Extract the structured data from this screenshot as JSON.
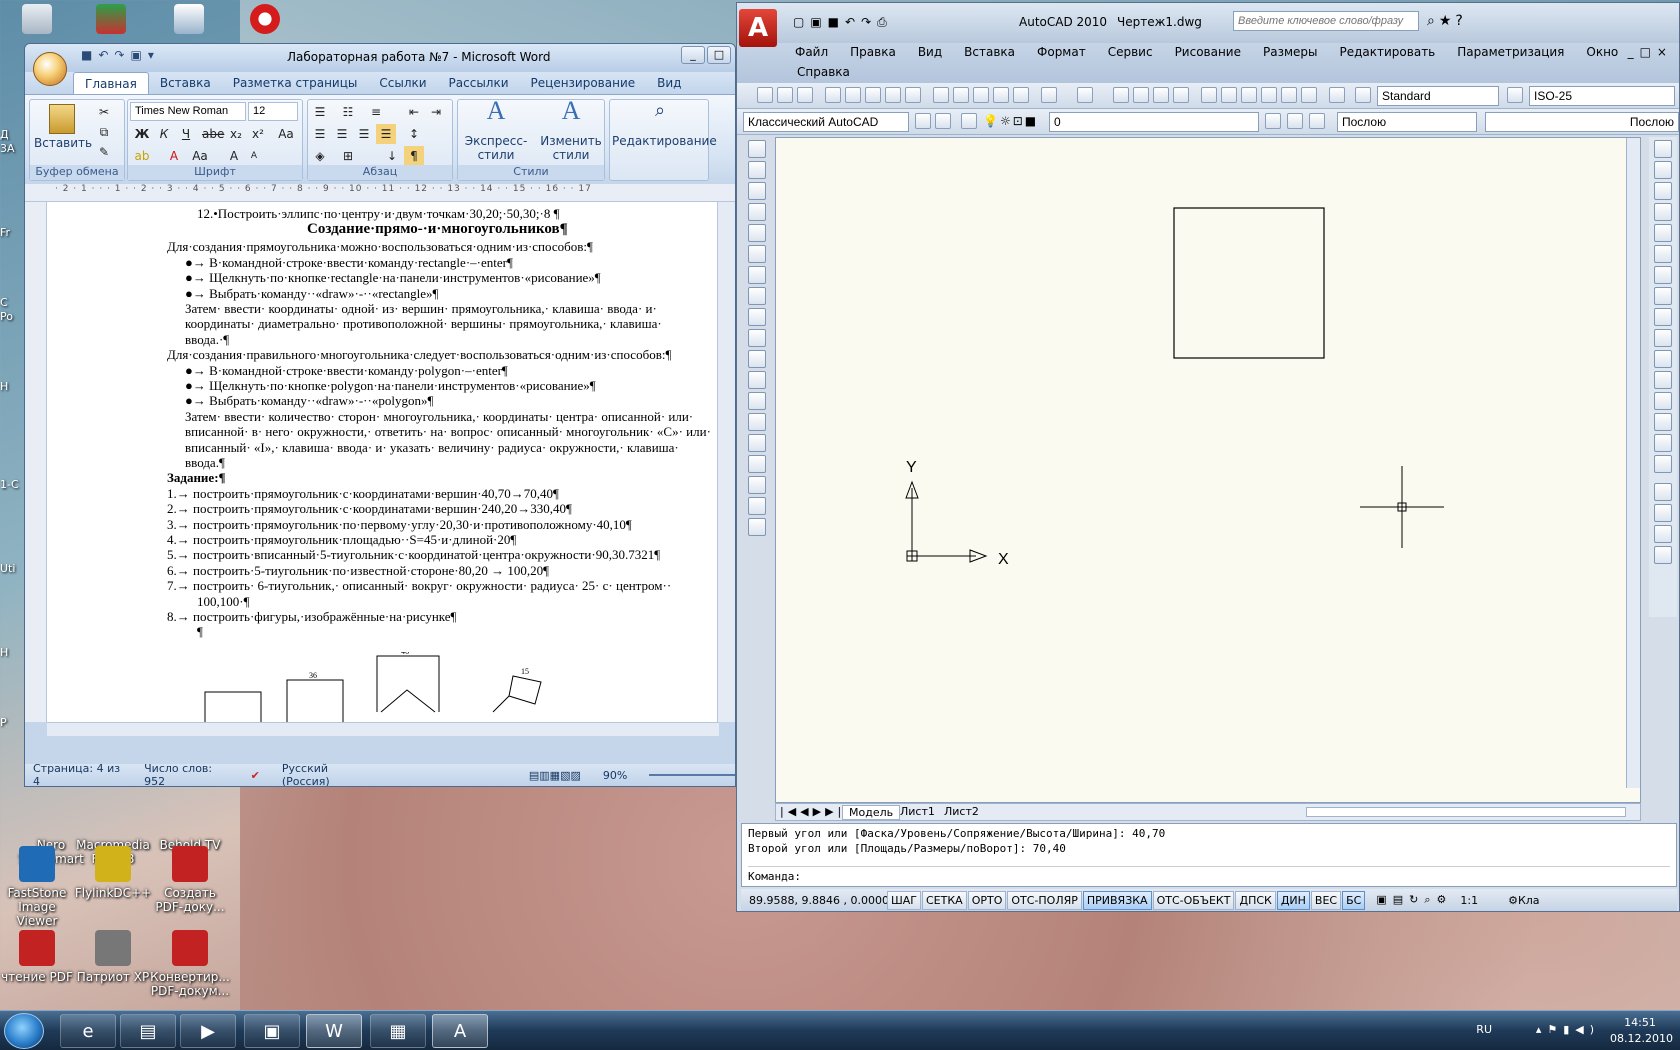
{
  "desktop": {
    "icons": [
      {
        "label": "Nero StartSmart",
        "color": "#444444"
      },
      {
        "label": "Macromedia Flash 8",
        "color": "#b01515"
      },
      {
        "label": "Behold TV",
        "color": "#2f5f9a"
      },
      {
        "label": "FastStone Image Viewer",
        "color": "#1f6bb5"
      },
      {
        "label": "FlylinkDC++",
        "color": "#d2b21a"
      },
      {
        "label": "Создать PDF-доку...",
        "color": "#c22222"
      },
      {
        "label": "чтение PDF",
        "color": "#c22222"
      },
      {
        "label": "Патриот XP",
        "color": "#777777"
      },
      {
        "label": "Конвертир... PDF-докум...",
        "color": "#c22222"
      }
    ],
    "partial_labels": [
      "Д",
      "3А",
      "Fr",
      "С",
      "Po",
      "Н",
      "1-С",
      "Uti",
      "Н",
      "Р"
    ]
  },
  "word": {
    "title": "Лабораторная работа №7 - Microsoft Word",
    "tabs": [
      "Главная",
      "Вставка",
      "Разметка страницы",
      "Ссылки",
      "Рассылки",
      "Рецензирование",
      "Вид"
    ],
    "groups": {
      "clipboard": "Буфер обмена",
      "font": "Шрифт",
      "paragraph": "Абзац",
      "styles": "Стили"
    },
    "paste": "Вставить",
    "font_name": "Times New Roman",
    "font_size": "12",
    "quick_styles": "Экспресс-стили",
    "change_styles": "Изменить стили",
    "editing": "Редактирование",
    "ruler": "· 2 · 1 · · · 1 · · 2 · · 3 · · 4 · · 5 · · 6 · · 7 · · 8 · · 9 · · 10 · · 11 · · 12 · · 13 · · 14 · · 15 · · 16 · · 17",
    "doc_lines": [
      {
        "text": "12.•Построить·эллипс·по·центру·и·двум·точкам·30,20;·50,30;·8                                          ¶",
        "style": "indent"
      },
      {
        "text": "Создание·прямо-·и·многоугольников¶",
        "style": "heading"
      },
      {
        "text": "Для·создания·прямоугольника·можно·воспользоваться·одним·из·способов:¶",
        "style": "normal"
      },
      {
        "text": "●→ В·командной·строке·ввести·команду·rectangle·–·enter¶",
        "style": "bullet"
      },
      {
        "text": "●→ Щелкнуть·по·кнопке·rectangle·на·панели·инструментов·«рисование»¶",
        "style": "bullet"
      },
      {
        "text": "●→ Выбрать·команду··«draw»·-··«rectangle»¶",
        "style": "bullet"
      },
      {
        "text": "Затем·  ввести·  координаты·  одной·  из·  вершин·  прямоугольника,·  клавиша·  ввода·  и·",
        "style": "cont"
      },
      {
        "text": "координаты·  диаметрально·  противоположной·  вершины·  прямоугольника,·  клавиша·",
        "style": "cont"
      },
      {
        "text": "ввода.·¶",
        "style": "cont"
      },
      {
        "text": "Для·создания·правильного·многоугольника·следует·воспользоваться·одним·из·способов:¶",
        "style": "normal"
      },
      {
        "text": "●→ В·командной·строке·ввести·команду·polygon·–·enter¶",
        "style": "bullet"
      },
      {
        "text": "●→ Щелкнуть·по·кнопке·polygon·на·панели·инструментов·«рисование»¶",
        "style": "bullet"
      },
      {
        "text": "●→ Выбрать·команду··«draw»·-··«polygon»¶",
        "style": "bullet"
      },
      {
        "text": "Затем·  ввести·  количество·  сторон·  многоугольника,·  координаты·  центра·  описанной·  или·",
        "style": "cont"
      },
      {
        "text": "вписанной·  в·  него·  окружности,·  ответить·  на·  вопрос·  описанный·  многоугольник·  «С»·  или·",
        "style": "cont"
      },
      {
        "text": "вписанный·  «I»,·  клавиша·  ввода·  и·  указать·  величину·  радиуса·  окружности,·  клавиша·",
        "style": "cont"
      },
      {
        "text": "ввода.¶",
        "style": "cont"
      },
      {
        "text": "Задание:¶",
        "style": "bold"
      },
      {
        "text": "1.→ построить·прямоугольник·с·координатами·вершин·40,70→70,40¶",
        "style": "normal"
      },
      {
        "text": "2.→ построить·прямоугольник·с·координатами·вершин·240,20→330,40¶",
        "style": "normal"
      },
      {
        "text": "3.→ построить·прямоугольник·по·первому·углу·20,30·и·противоположному·40,10¶",
        "style": "normal"
      },
      {
        "text": "4.→ построить·прямоугольник·площадью··S=45·и·длиной·20¶",
        "style": "normal"
      },
      {
        "text": "5.→ построить·вписанный·5-тиугольник·с·координатой·центра·окружности·90,30.7321¶",
        "style": "normal"
      },
      {
        "text": "6.→ построить·5-тиугольник·по·известной·стороне·80,20    →     100,20¶",
        "style": "normal"
      },
      {
        "text": "7.→ построить·  6-тиугольник,·  описанный·  вокруг·  окружности·  радиуса·  25·  с·  центром··",
        "style": "normal"
      },
      {
        "text": "100,100·¶",
        "style": "cont2"
      },
      {
        "text": "8.→ построить·фигуры,·изображённые·на·рисунке¶",
        "style": "normal"
      },
      {
        "text": "¶",
        "style": "cont2"
      }
    ],
    "fig_labels": [
      "36",
      "46",
      "15"
    ],
    "status": {
      "page": "Страница: 4 из 4",
      "words": "Число слов: 952",
      "lang": "Русский (Россия)",
      "zoom": "90%"
    }
  },
  "autocad": {
    "app": "AutoCAD 2010",
    "file": "Чертеж1.dwg",
    "search_placeholder": "Введите ключевое слово/фразу",
    "menu": [
      "Файл",
      "Правка",
      "Вид",
      "Вставка",
      "Формат",
      "Сервис",
      "Рисование",
      "Размеры",
      "Редактировать",
      "Параметризация",
      "Окно"
    ],
    "menu_row2": "Справка",
    "text_style": "Standard",
    "dim_style": "ISO-25",
    "workspace": "Классический AutoCAD",
    "layer": "0",
    "color": "Послою",
    "linetype": "Послою",
    "ucs": {
      "x": "X",
      "y": "Y"
    },
    "layout_tabs": [
      "Модель",
      "Лист1",
      "Лист2"
    ],
    "cmd_history": [
      "Первый угол или [Фаска/Уровень/Сопряжение/Высота/Ширина]: 40,70",
      "Второй угол или [Площадь/Размеры/поВорот]: 70,40"
    ],
    "cmd_prompt": "Команда:",
    "coords": "89.9588, 9.8846 , 0.0000",
    "toggles": [
      {
        "label": "ШАГ",
        "on": false
      },
      {
        "label": "СЕТКА",
        "on": false
      },
      {
        "label": "ОРТО",
        "on": false
      },
      {
        "label": "ОТС-ПОЛЯР",
        "on": false
      },
      {
        "label": "ПРИВЯЗКА",
        "on": true
      },
      {
        "label": "ОТС-ОБЪЕКТ",
        "on": false
      },
      {
        "label": "ДПСК",
        "on": false
      },
      {
        "label": "ДИН",
        "on": true
      },
      {
        "label": "ВЕС",
        "on": false
      },
      {
        "label": "БС",
        "on": true
      }
    ],
    "scale": "1:1",
    "status_tail": "Кла"
  },
  "taskbar": {
    "lang": "RU",
    "time": "14:51",
    "date": "08.12.2010"
  }
}
